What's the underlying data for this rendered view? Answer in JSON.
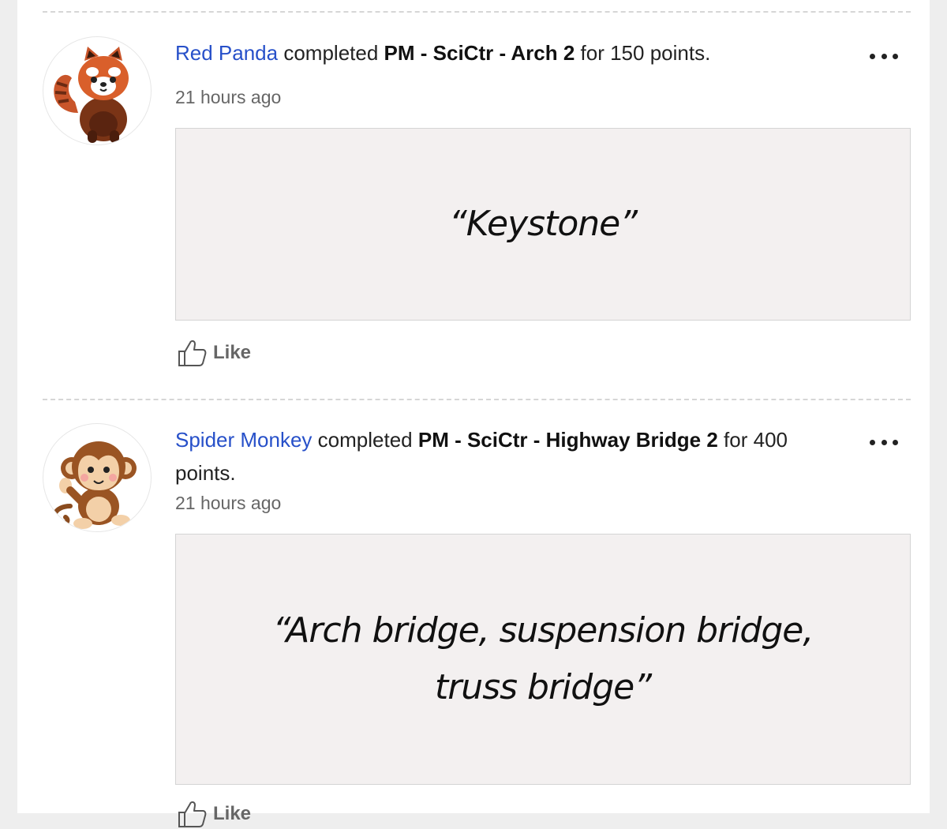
{
  "feed": {
    "posts": [
      {
        "user": "Red Panda",
        "completed_text": "completed",
        "activity": "PM - SciCtr - Arch 2",
        "points_text": "for 150 points.",
        "time": "21 hours ago",
        "response": "“Keystone”",
        "avatar_icon": "red-panda-icon",
        "like_label": "Like"
      },
      {
        "user": "Spider Monkey",
        "completed_text": "completed",
        "activity": "PM - SciCtr - Highway Bridge 2",
        "points_text": "for 400 points.",
        "time": "21 hours ago",
        "response_line1": "“Arch bridge, suspension bridge,",
        "response_line2": "truss bridge”",
        "avatar_icon": "monkey-icon",
        "like_label": "Like"
      }
    ]
  },
  "colors": {
    "user_link": "#2750c9",
    "response_bg": "#f3f0f0",
    "page_bg": "#eeeeee"
  }
}
